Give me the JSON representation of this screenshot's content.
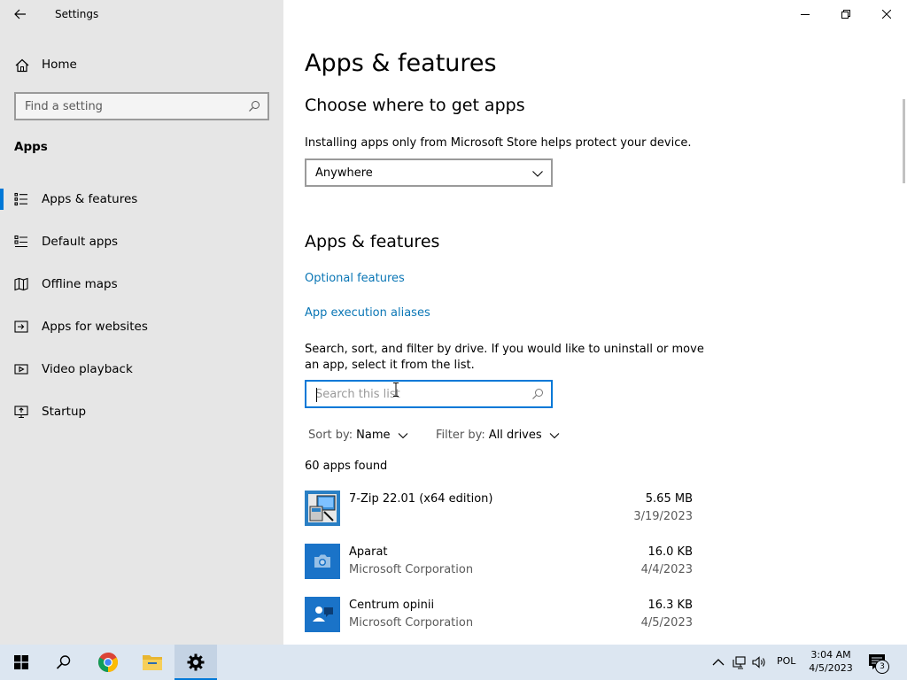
{
  "window": {
    "title": "Settings"
  },
  "sidebar": {
    "home_label": "Home",
    "search_placeholder": "Find a setting",
    "section_title": "Apps",
    "items": [
      {
        "label": "Apps & features",
        "icon": "apps-features-icon",
        "active": true
      },
      {
        "label": "Default apps",
        "icon": "default-apps-icon"
      },
      {
        "label": "Offline maps",
        "icon": "offline-maps-icon"
      },
      {
        "label": "Apps for websites",
        "icon": "apps-websites-icon"
      },
      {
        "label": "Video playback",
        "icon": "video-playback-icon"
      },
      {
        "label": "Startup",
        "icon": "startup-icon"
      }
    ]
  },
  "main": {
    "page_title": "Apps & features",
    "choose": {
      "heading": "Choose where to get apps",
      "description": "Installing apps only from Microsoft Store helps protect your device.",
      "selected_option": "Anywhere"
    },
    "features": {
      "heading": "Apps & features",
      "links": [
        "Optional features",
        "App execution aliases"
      ],
      "description": "Search, sort, and filter by drive. If you would like to uninstall or move an app, select it from the list.",
      "search_placeholder": "Search this list",
      "sort_key": "Sort by:",
      "sort_value": "Name",
      "filter_key": "Filter by:",
      "filter_value": "All drives",
      "count_text": "60 apps found"
    },
    "apps": [
      {
        "name": "7-Zip 22.01 (x64 edition)",
        "publisher": "",
        "size": "5.65 MB",
        "date": "3/19/2023",
        "icon": "7zip-icon"
      },
      {
        "name": "Aparat",
        "publisher": "Microsoft Corporation",
        "size": "16.0 KB",
        "date": "4/4/2023",
        "icon": "camera-icon"
      },
      {
        "name": "Centrum opinii",
        "publisher": "Microsoft Corporation",
        "size": "16.3 KB",
        "date": "4/5/2023",
        "icon": "feedback-hub-icon"
      }
    ]
  },
  "taskbar": {
    "language": "POL",
    "time": "3:04 AM",
    "date": "4/5/2023",
    "notification_count": "3",
    "accent": "#0078d7"
  }
}
